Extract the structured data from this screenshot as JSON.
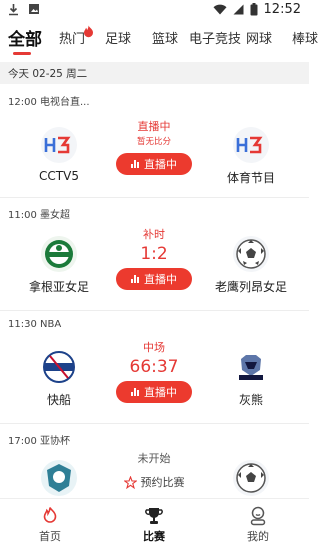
{
  "status_bar": {
    "time": "12:52"
  },
  "tabs": [
    {
      "label": "全部",
      "active": true
    },
    {
      "label": "热门",
      "badge": "hot"
    },
    {
      "label": "足球"
    },
    {
      "label": "篮球"
    },
    {
      "label": "电子竞技"
    },
    {
      "label": "网球"
    },
    {
      "label": "棒球"
    }
  ],
  "date_bar": {
    "text": "今天 02-25 周二"
  },
  "matches": [
    {
      "header": "12:00 电视台直...",
      "home": {
        "name": "CCTV5"
      },
      "away": {
        "name": "体育节目"
      },
      "status": "直播中",
      "sub": "暂无比分",
      "button": "直播中"
    },
    {
      "header": "11:00 墨女超",
      "home": {
        "name": "拿根亚女足"
      },
      "away": {
        "name": "老鹰列昂女足"
      },
      "status": "补时",
      "score": "1:2",
      "button": "直播中"
    },
    {
      "header": "11:30 NBA",
      "home": {
        "name": "快船"
      },
      "away": {
        "name": "灰熊"
      },
      "status": "中场",
      "score": "66:37",
      "button": "直播中"
    },
    {
      "header": "17:00 亚协杯",
      "home": {
        "name": ""
      },
      "away": {
        "name": ""
      },
      "status": "未开始",
      "reserve": "预约比赛"
    }
  ],
  "bottom_nav": [
    {
      "label": "首页"
    },
    {
      "label": "比赛",
      "active": true
    },
    {
      "label": "我的"
    }
  ],
  "colors": {
    "accent": "#e53935",
    "live_button": "#ec3a2e"
  }
}
